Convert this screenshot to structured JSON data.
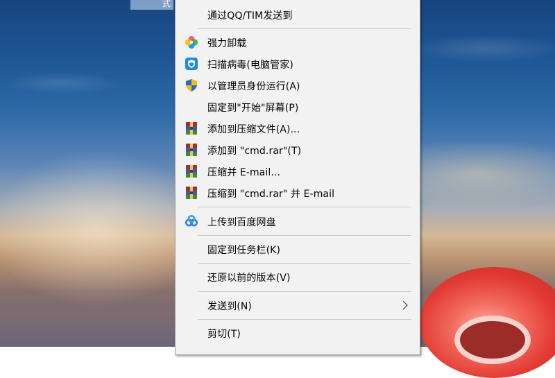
{
  "desktop": {
    "selected_item_fragment": "式"
  },
  "context_menu": {
    "items": [
      {
        "label": "通过QQ/TIM发送到",
        "icon": "none"
      },
      {
        "label": "强力卸载",
        "icon": "pinwheel-icon"
      },
      {
        "label": "扫描病毒(电脑管家)",
        "icon": "tencent-pc-manager-shield-icon"
      },
      {
        "label": "以管理员身份运行(A)",
        "icon": "uac-shield-icon"
      },
      {
        "label": "固定到\"开始\"屏幕(P)",
        "icon": "none"
      },
      {
        "label": "添加到压缩文件(A)...",
        "icon": "winrar-icon"
      },
      {
        "label": "添加到 \"cmd.rar\"(T)",
        "icon": "winrar-icon"
      },
      {
        "label": "压缩并 E-mail...",
        "icon": "winrar-icon"
      },
      {
        "label": "压缩到 \"cmd.rar\" 并 E-mail",
        "icon": "winrar-icon"
      },
      {
        "label": "上传到百度网盘",
        "icon": "baidu-netdisk-icon"
      },
      {
        "label": "固定到任务栏(K)",
        "icon": "none"
      },
      {
        "label": "还原以前的版本(V)",
        "icon": "none"
      },
      {
        "label": "发送到(N)",
        "icon": "none",
        "submenu": true
      },
      {
        "label": "剪切(T)",
        "icon": "none"
      }
    ]
  },
  "colors": {
    "menu_background": "#f2f2f2",
    "menu_border": "#a0a0a0",
    "separator": "#c8c8c8",
    "text": "#000000"
  }
}
